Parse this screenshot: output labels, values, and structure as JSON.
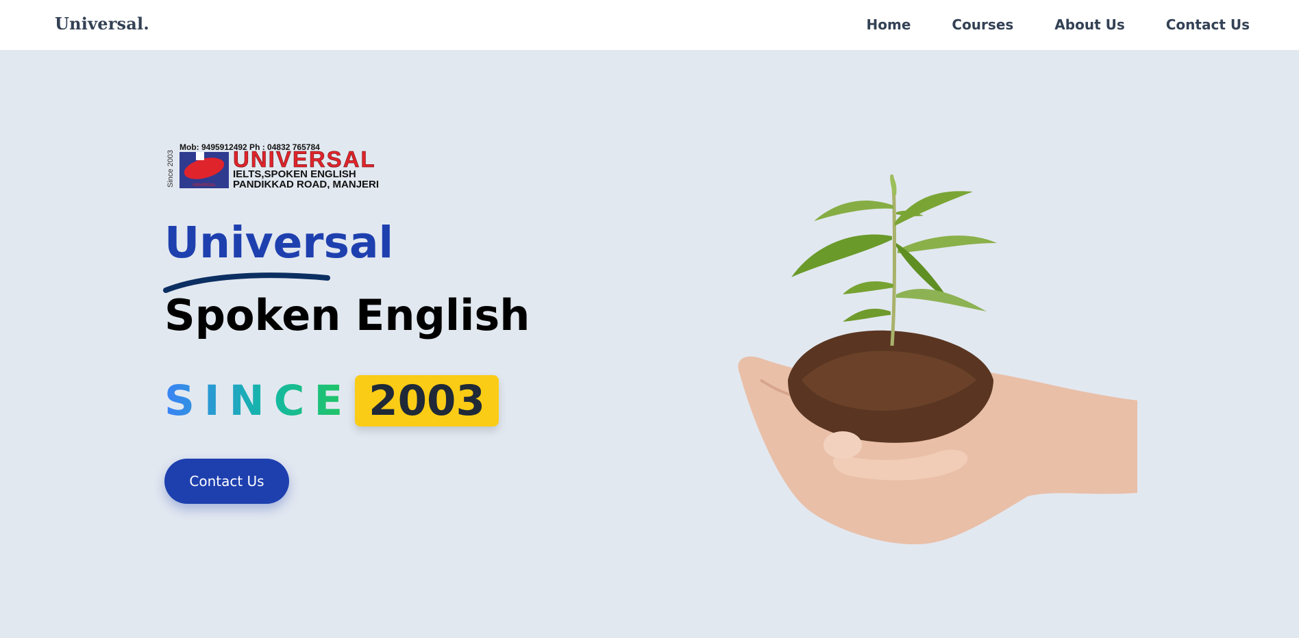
{
  "navbar": {
    "brand": "Universal.",
    "links": [
      "Home",
      "Courses",
      "About Us",
      "Contact Us"
    ]
  },
  "logo": {
    "top_line": "Mob: 9495912492     Ph : 04832 765784",
    "since_vertical": "Since 2003",
    "name": "UNIVERSAL",
    "line2": "IELTS,SPOKEN ENGLISH",
    "line3": "PANDIKKAD ROAD, MANJERI",
    "emblem_text": "UNIVERSAL"
  },
  "hero": {
    "title_line1": "Universal",
    "title_line2": "Spoken English",
    "since_label": "SINCE",
    "since_year": "2003",
    "cta_label": "Contact Us"
  },
  "colors": {
    "background": "#e2e8f0",
    "primary": "#1e40af",
    "badge": "#facc15",
    "nav_text": "#334155"
  },
  "icons": {
    "hero_image": "plant-in-hand-image",
    "logo": "universal-logo"
  }
}
